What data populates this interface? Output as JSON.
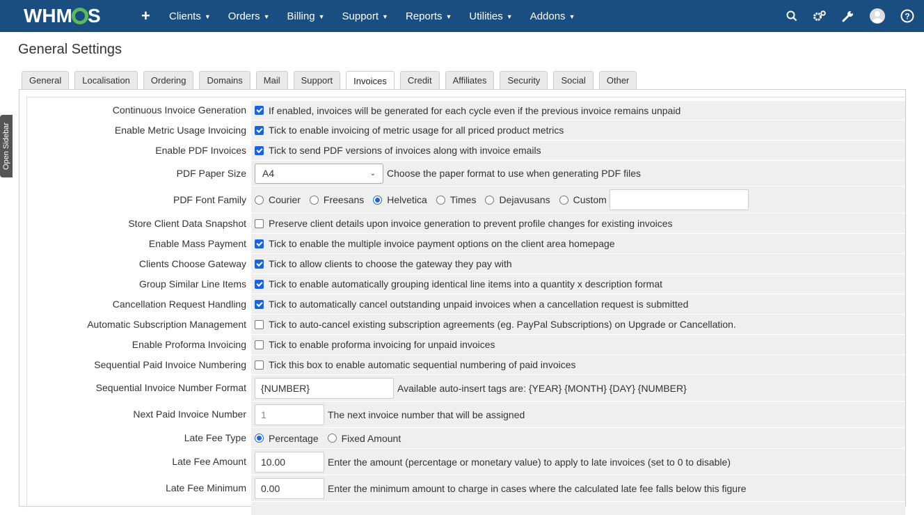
{
  "brand": {
    "logo_text_left": "WHM",
    "logo_text_right": "S"
  },
  "nav": {
    "add_icon": "plus-icon",
    "items": [
      "Clients",
      "Orders",
      "Billing",
      "Support",
      "Reports",
      "Utilities",
      "Addons"
    ],
    "right_icons": [
      "search-icon",
      "cogs-icon",
      "wrench-icon",
      "avatar-icon",
      "help-icon"
    ]
  },
  "sidebar_toggle": "Open Sidebar",
  "page_title": "General Settings",
  "tabs": [
    "General",
    "Localisation",
    "Ordering",
    "Domains",
    "Mail",
    "Support",
    "Invoices",
    "Credit",
    "Affiliates",
    "Security",
    "Social",
    "Other"
  ],
  "active_tab": "Invoices",
  "settings": {
    "continuous": {
      "label": "Continuous Invoice Generation",
      "checked": true,
      "text": "If enabled, invoices will be generated for each cycle even if the previous invoice remains unpaid"
    },
    "metric": {
      "label": "Enable Metric Usage Invoicing",
      "checked": true,
      "text": "Tick to enable invoicing of metric usage for all priced product metrics"
    },
    "pdf": {
      "label": "Enable PDF Invoices",
      "checked": true,
      "text": "Tick to send PDF versions of invoices along with invoice emails"
    },
    "paper": {
      "label": "PDF Paper Size",
      "value": "A4",
      "text": "Choose the paper format to use when generating PDF files"
    },
    "font": {
      "label": "PDF Font Family",
      "options": [
        "Courier",
        "Freesans",
        "Helvetica",
        "Times",
        "Dejavusans",
        "Custom"
      ],
      "selected": "Helvetica",
      "custom_value": ""
    },
    "snapshot": {
      "label": "Store Client Data Snapshot",
      "checked": false,
      "text": "Preserve client details upon invoice generation to prevent profile changes for existing invoices"
    },
    "mass": {
      "label": "Enable Mass Payment",
      "checked": true,
      "text": "Tick to enable the multiple invoice payment options on the client area homepage"
    },
    "gateway": {
      "label": "Clients Choose Gateway",
      "checked": true,
      "text": "Tick to allow clients to choose the gateway they pay with"
    },
    "group": {
      "label": "Group Similar Line Items",
      "checked": true,
      "text": "Tick to enable automatically grouping identical line items into a quantity x description format"
    },
    "cancel": {
      "label": "Cancellation Request Handling",
      "checked": true,
      "text": "Tick to automatically cancel outstanding unpaid invoices when a cancellation request is submitted"
    },
    "subscription": {
      "label": "Automatic Subscription Management",
      "checked": false,
      "text": "Tick to auto-cancel existing subscription agreements (eg. PayPal Subscriptions) on Upgrade or Cancellation."
    },
    "proforma": {
      "label": "Enable Proforma Invoicing",
      "checked": false,
      "text": "Tick to enable proforma invoicing for unpaid invoices"
    },
    "sequential": {
      "label": "Sequential Paid Invoice Numbering",
      "checked": false,
      "text": "Tick this box to enable automatic sequential numbering of paid invoices"
    },
    "format": {
      "label": "Sequential Invoice Number Format",
      "value": "{NUMBER}",
      "text": "Available auto-insert tags are: {YEAR} {MONTH} {DAY} {NUMBER}"
    },
    "next": {
      "label": "Next Paid Invoice Number",
      "value": "1",
      "text": "The next invoice number that will be assigned"
    },
    "latefeetype": {
      "label": "Late Fee Type",
      "options": [
        "Percentage",
        "Fixed Amount"
      ],
      "selected": "Percentage"
    },
    "latefee": {
      "label": "Late Fee Amount",
      "value": "10.00",
      "text": "Enter the amount (percentage or monetary value) to apply to late invoices (set to 0 to disable)"
    },
    "latemin": {
      "label": "Late Fee Minimum",
      "value": "0.00",
      "text": "Enter the minimum amount to charge in cases where the calculated late fee falls below this figure"
    }
  }
}
